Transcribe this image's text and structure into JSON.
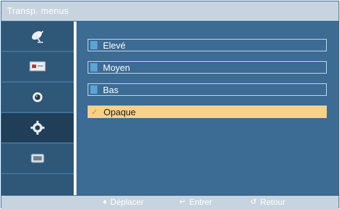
{
  "menu": {
    "title": "Transp. menus"
  },
  "sidebar": {
    "items": [
      {
        "icon": "satellite-dish-icon"
      },
      {
        "icon": "picture-icon"
      },
      {
        "icon": "sound-icon"
      },
      {
        "icon": "gear-icon",
        "active": true
      },
      {
        "icon": "input-icon"
      }
    ]
  },
  "options": [
    {
      "label": "Elevé",
      "selected": false
    },
    {
      "label": "Moyen",
      "selected": false
    },
    {
      "label": "Bas",
      "selected": false
    },
    {
      "label": "Opaque",
      "selected": true
    }
  ],
  "footer": {
    "move_label": "Déplacer",
    "enter_label": "Entrer",
    "return_label": "Retour"
  },
  "colors": {
    "background": "#3b6a93",
    "title_bar": "#c7d4df",
    "sidebar": "#2e5778",
    "selected_option": "#f7d18a",
    "option_marker": "#5aa5d6"
  }
}
